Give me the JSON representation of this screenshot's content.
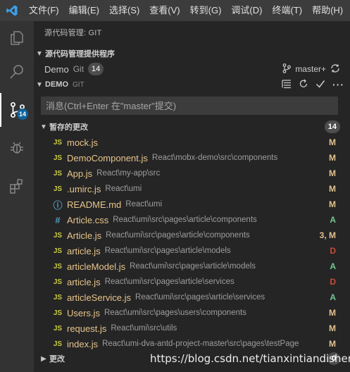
{
  "menu": [
    "文件(F)",
    "编辑(E)",
    "选择(S)",
    "查看(V)",
    "转到(G)",
    "调试(D)",
    "终端(T)",
    "帮助(H)"
  ],
  "activity": {
    "scm_badge": "14"
  },
  "sidebar": {
    "title": "源代码管理: GIT",
    "providers_header": "源代码管理提供程序",
    "provider": {
      "name": "Demo",
      "type": "Git",
      "count": "14",
      "branch": "master+"
    },
    "repo_header": "DEMO",
    "repo_sub": "GIT",
    "commit_placeholder": "消息(Ctrl+Enter 在\"master\"提交)",
    "staged_header": "暂存的更改",
    "staged_count": "14",
    "changes_header": "更改",
    "changes_count": "0"
  },
  "files": [
    {
      "icon": "JS",
      "kind": "js",
      "name": "mock.js",
      "path": "",
      "status": "M"
    },
    {
      "icon": "JS",
      "kind": "js",
      "name": "DemoComponent.js",
      "path": "React\\mobx-demo\\src\\components",
      "status": "M"
    },
    {
      "icon": "JS",
      "kind": "js",
      "name": "App.js",
      "path": "React\\my-app\\src",
      "status": "M"
    },
    {
      "icon": "JS",
      "kind": "js",
      "name": ".umirc.js",
      "path": "React\\umi",
      "status": "M"
    },
    {
      "icon": "ⓘ",
      "kind": "info",
      "name": "README.md",
      "path": "React\\umi",
      "status": "M"
    },
    {
      "icon": "#",
      "kind": "css",
      "name": "Article.css",
      "path": "React\\umi\\src\\pages\\article\\components",
      "status": "A"
    },
    {
      "icon": "JS",
      "kind": "js",
      "name": "Article.js",
      "path": "React\\umi\\src\\pages\\article\\components",
      "status": "3, M"
    },
    {
      "icon": "JS",
      "kind": "js",
      "name": "article.js",
      "path": "React\\umi\\src\\pages\\article\\models",
      "status": "D"
    },
    {
      "icon": "JS",
      "kind": "js",
      "name": "articleModel.js",
      "path": "React\\umi\\src\\pages\\article\\models",
      "status": "A"
    },
    {
      "icon": "JS",
      "kind": "js",
      "name": "article.js",
      "path": "React\\umi\\src\\pages\\article\\services",
      "status": "D"
    },
    {
      "icon": "JS",
      "kind": "js",
      "name": "articleService.js",
      "path": "React\\umi\\src\\pages\\article\\services",
      "status": "A"
    },
    {
      "icon": "JS",
      "kind": "js",
      "name": "Users.js",
      "path": "React\\umi\\src\\pages\\users\\components",
      "status": "M"
    },
    {
      "icon": "JS",
      "kind": "js",
      "name": "request.js",
      "path": "React\\umi\\src\\utils",
      "status": "M"
    },
    {
      "icon": "JS",
      "kind": "js",
      "name": "index.js",
      "path": "React\\umi-dva-antd-project-master\\src\\pages\\testPage",
      "status": "M"
    }
  ],
  "watermark": "https://blog.csdn.net/tianxintiandisheng"
}
